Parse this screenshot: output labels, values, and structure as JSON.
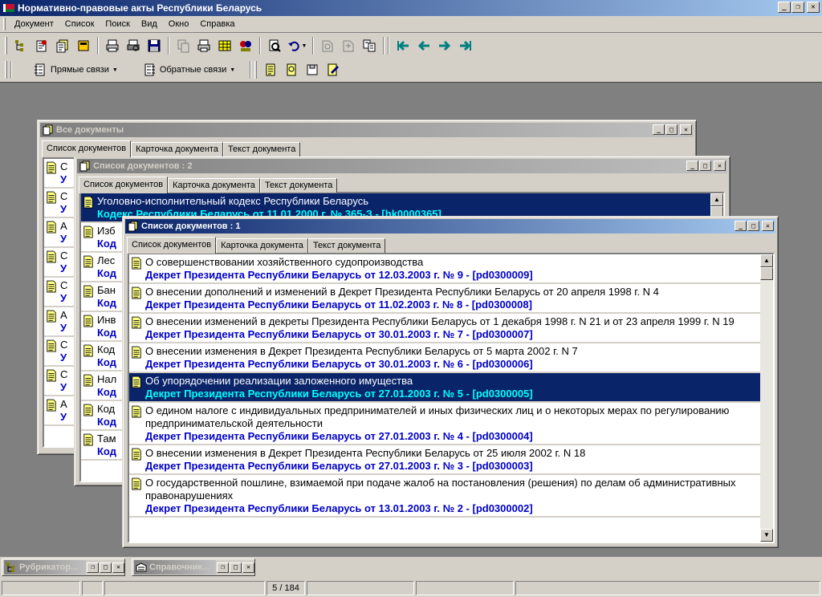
{
  "app": {
    "title": "Нормативно-правовые акты Республики Беларусь",
    "flag_colors": [
      "#c8102e",
      "#007a33"
    ]
  },
  "menu": [
    "Документ",
    "Список",
    "Поиск",
    "Вид",
    "Окно",
    "Справка"
  ],
  "toolbar2": {
    "direct_links": "Прямые связи",
    "reverse_links": "Обратные связи"
  },
  "tabs": {
    "list": "Список документов",
    "card": "Карточка документа",
    "text": "Текст документа"
  },
  "windows": {
    "all_docs": {
      "title": "Все документы",
      "rows": [
        {
          "name": "С",
          "sub": "У"
        },
        {
          "name": "С",
          "sub": "У"
        },
        {
          "name": "А",
          "sub": "У"
        },
        {
          "name": "С",
          "sub": "У"
        },
        {
          "name": "С",
          "sub": "У"
        },
        {
          "name": "А",
          "sub": "У"
        },
        {
          "name": "С",
          "sub": "У"
        },
        {
          "name": "С",
          "sub": "У"
        },
        {
          "name": "А",
          "sub": "У"
        }
      ]
    },
    "list2": {
      "title": "Список документов : 2",
      "rows": [
        {
          "name": "Уголовно-исполнительный кодекс Республики Беларусь",
          "sub": "Кодекс Республики Беларусь от 11.01.2000 г. № 365-З - [hk0000365]",
          "selected": true
        },
        {
          "name": "Изб",
          "sub": "Код"
        },
        {
          "name": "Лес",
          "sub": "Код"
        },
        {
          "name": "Бан",
          "sub": "Код"
        },
        {
          "name": "Инв",
          "sub": "Код"
        },
        {
          "name": "Код",
          "sub": "Код"
        },
        {
          "name": "Нал",
          "sub": "Код"
        },
        {
          "name": "Код",
          "sub": "Код"
        },
        {
          "name": "Там",
          "sub": "Код"
        }
      ]
    },
    "list1": {
      "title": "Список документов : 1",
      "rows": [
        {
          "name": "О совершенствовании хозяйственного судопроизводства",
          "sub": "Декрет Президента Республики Беларусь от 12.03.2003 г. № 9 - [pd0300009]"
        },
        {
          "name": "О внесении дополнений и изменений в Декрет Президента Республики Беларусь от 20 апреля 1998 г. N 4",
          "sub": "Декрет Президента Республики Беларусь от 11.02.2003 г. № 8 - [pd0300008]"
        },
        {
          "name": "О внесении изменений в декреты Президента Республики Беларусь от 1 декабря 1998 г. N 21 и от 23 апреля 1999 г. N 19",
          "sub": "Декрет Президента Республики Беларусь от 30.01.2003 г. № 7 - [pd0300007]"
        },
        {
          "name": "О внесении изменения в Декрет Президента Республики Беларусь от 5 марта 2002 г. N 7",
          "sub": "Декрет Президента Республики Беларусь от 30.01.2003 г. № 6 - [pd0300006]"
        },
        {
          "name": "Об упорядочении реализации заложенного имущества",
          "sub": "Декрет Президента Республики Беларусь от 27.01.2003 г. № 5 - [pd0300005]",
          "selected": true
        },
        {
          "name": "О едином налоге с индивидуальных предпринимателей и иных физических лиц и о некоторых мерах по регулированию предпринимательской деятельности",
          "sub": "Декрет Президента Республики Беларусь от 27.01.2003 г. № 4 - [pd0300004]"
        },
        {
          "name": "О внесении изменения в Декрет Президента Республики Беларусь от 25 июля 2002 г. N 18",
          "sub": "Декрет Президента Республики Беларусь от 27.01.2003 г. № 3 - [pd0300003]"
        },
        {
          "name": "О государственной пошлине, взимаемой при подаче жалоб на постановления (решения) по делам об административных правонарушениях",
          "sub": "Декрет Президента Республики Беларусь от 13.01.2003 г. № 2 - [pd0300002]"
        }
      ]
    }
  },
  "minimized": [
    {
      "title": "Рубрикатор...",
      "icon": "rubricator-icon"
    },
    {
      "title": "Справочник...",
      "icon": "directory-icon"
    }
  ],
  "status": {
    "position": "5 / 184"
  }
}
